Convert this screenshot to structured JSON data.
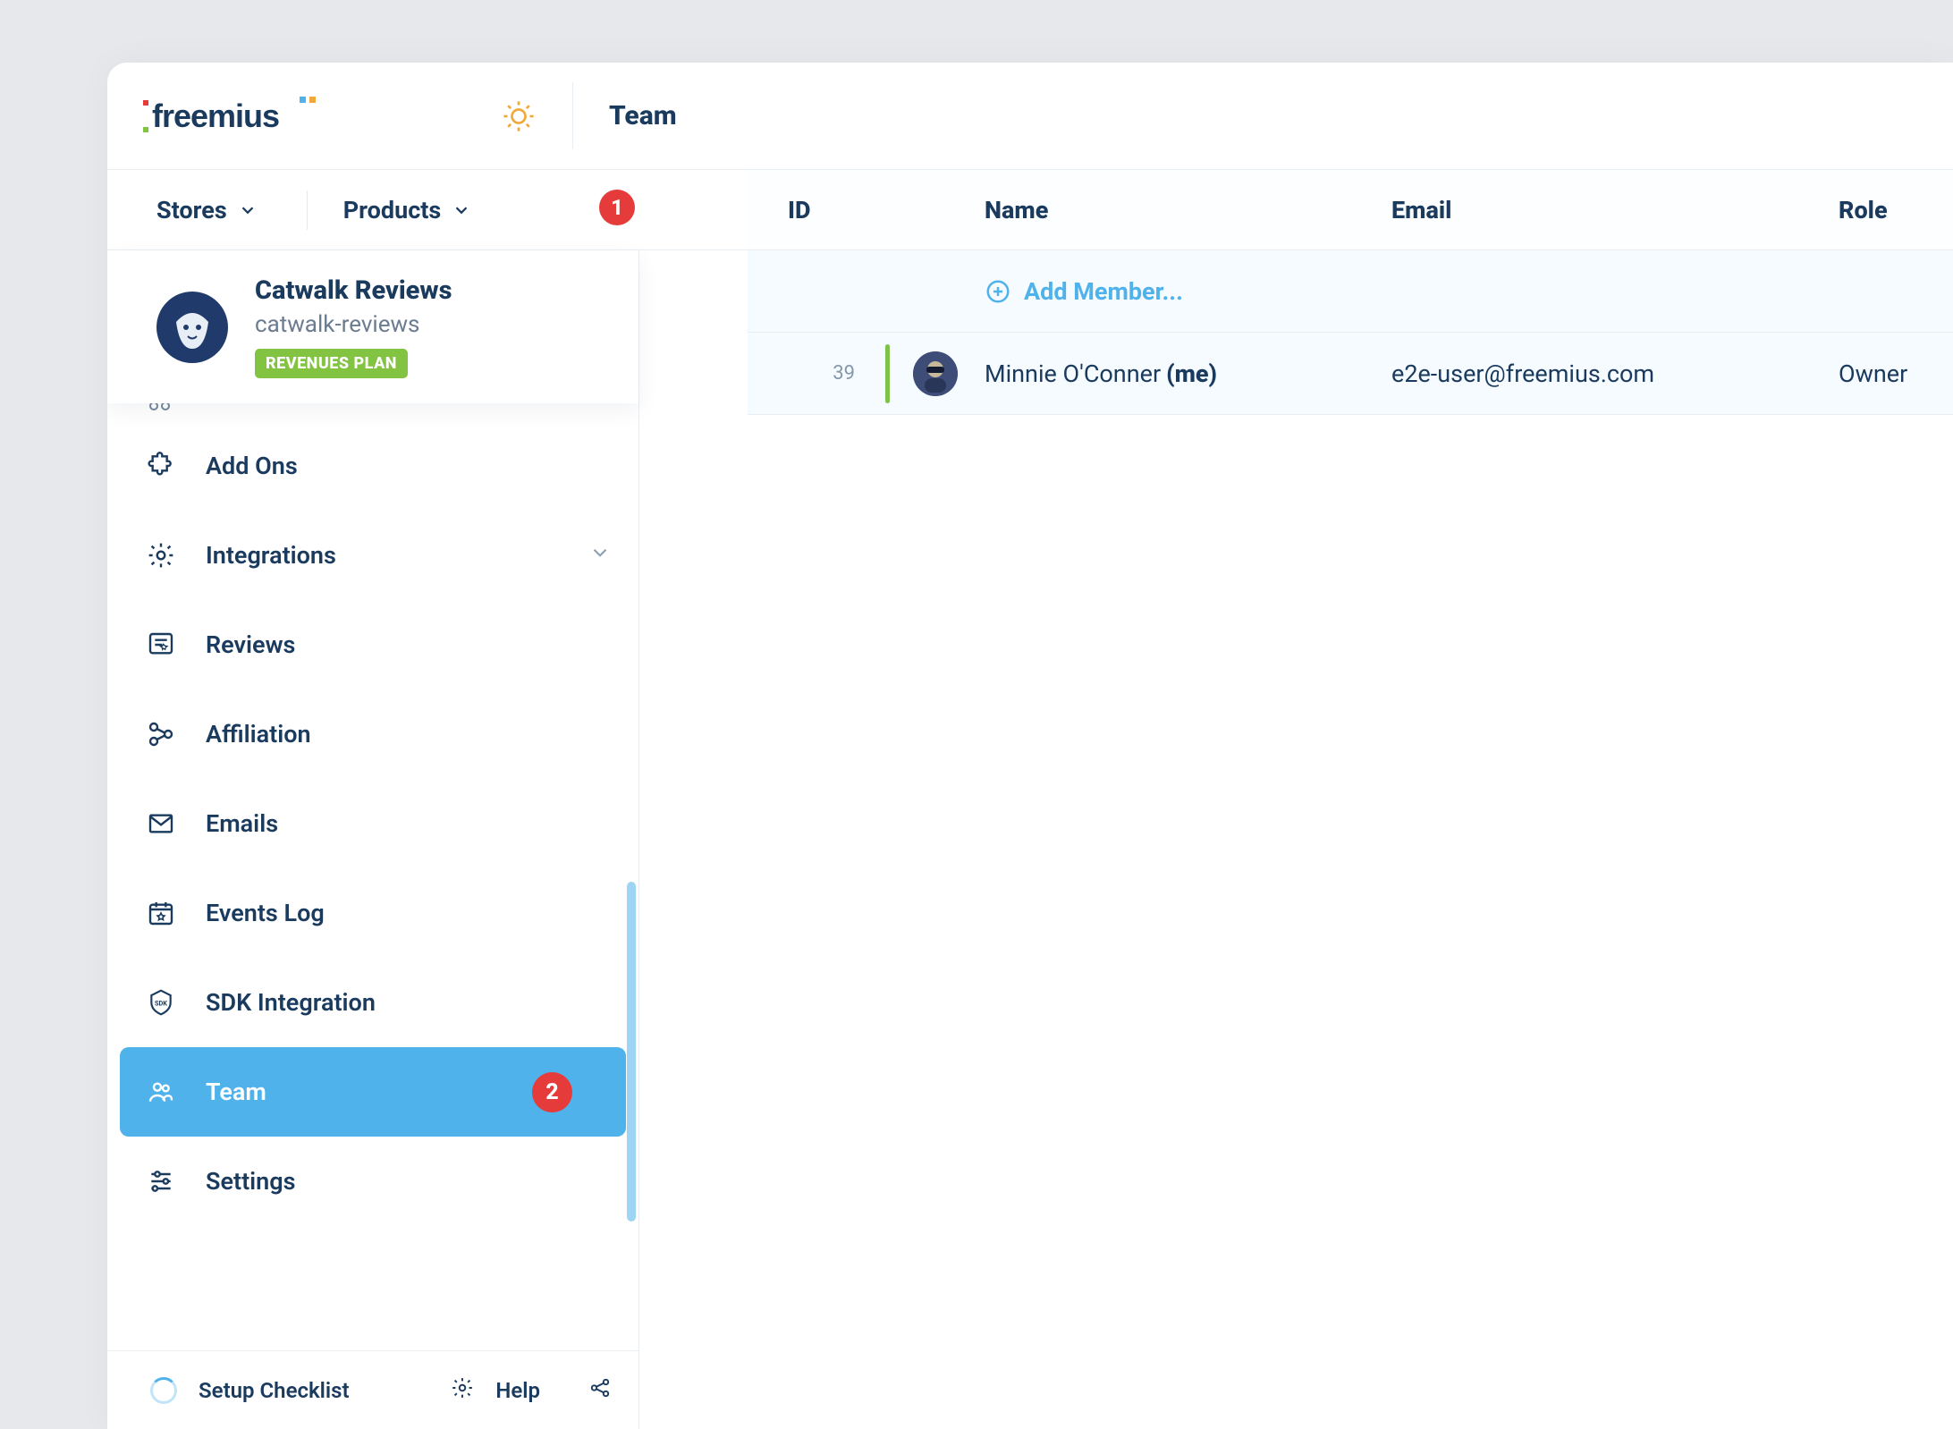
{
  "header": {
    "title": "Team"
  },
  "nav": {
    "stores_label": "Stores",
    "products_label": "Products",
    "products_badge": "1"
  },
  "product_card": {
    "name": "Catwalk Reviews",
    "slug": "catwalk-reviews",
    "plan_badge": "REVENUES PLAN"
  },
  "sidebar": {
    "items": {
      "addons": "Add Ons",
      "integrations": "Integrations",
      "reviews": "Reviews",
      "affiliation": "Affiliation",
      "emails": "Emails",
      "events_log": "Events Log",
      "sdk_integration": "SDK Integration",
      "team": "Team",
      "settings": "Settings"
    },
    "team_badge": "2"
  },
  "sidebar_footer": {
    "checklist": "Setup Checklist",
    "help": "Help"
  },
  "table": {
    "headers": {
      "id": "ID",
      "name": "Name",
      "email": "Email",
      "role": "Role"
    },
    "add_member_label": "Add Member...",
    "rows": [
      {
        "id": "39",
        "name": "Minnie O'Conner ",
        "me_suffix": "(me)",
        "email": "e2e-user@freemius.com",
        "role": "Owner"
      }
    ]
  }
}
